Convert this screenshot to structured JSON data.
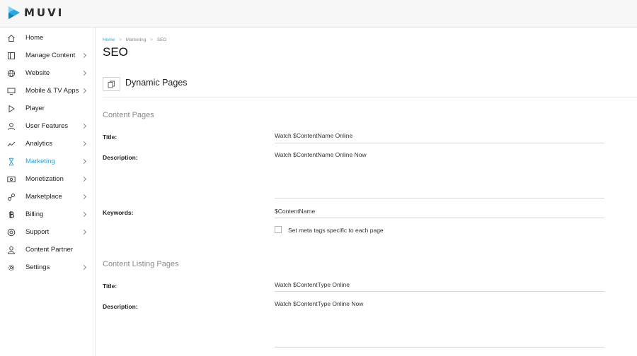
{
  "app": {
    "logo_text": "MUVI"
  },
  "sidebar": {
    "items": [
      {
        "label": "Home",
        "icon": "home-icon",
        "chevron": false,
        "active": false
      },
      {
        "label": "Manage Content",
        "icon": "content-icon",
        "chevron": true,
        "active": false
      },
      {
        "label": "Website",
        "icon": "globe-icon",
        "chevron": true,
        "active": false
      },
      {
        "label": "Mobile & TV Apps",
        "icon": "monitor-icon",
        "chevron": true,
        "active": false
      },
      {
        "label": "Player",
        "icon": "play-icon",
        "chevron": false,
        "active": false
      },
      {
        "label": "User Features",
        "icon": "user-icon",
        "chevron": true,
        "active": false
      },
      {
        "label": "Analytics",
        "icon": "analytics-icon",
        "chevron": true,
        "active": false
      },
      {
        "label": "Marketing",
        "icon": "hourglass-icon",
        "chevron": true,
        "active": true
      },
      {
        "label": "Monetization",
        "icon": "money-icon",
        "chevron": true,
        "active": false
      },
      {
        "label": "Marketplace",
        "icon": "link-icon",
        "chevron": true,
        "active": false
      },
      {
        "label": "Billing",
        "icon": "bitcoin-icon",
        "chevron": true,
        "active": false
      },
      {
        "label": "Support",
        "icon": "support-icon",
        "chevron": true,
        "active": false
      },
      {
        "label": "Content Partner",
        "icon": "partner-icon",
        "chevron": false,
        "active": false
      },
      {
        "label": "Settings",
        "icon": "gear-icon",
        "chevron": true,
        "active": false
      }
    ]
  },
  "breadcrumb": {
    "home": "Home",
    "marketing": "Marketing",
    "current": "SEO",
    "separator": ">"
  },
  "page": {
    "title": "SEO"
  },
  "dynamic_pages": {
    "title": "Dynamic Pages",
    "icon": "copy-icon"
  },
  "content_pages": {
    "title": "Content Pages",
    "title_label": "Title:",
    "title_value": "Watch $ContentName Online",
    "description_label": "Description:",
    "description_value": "Watch $ContentName Online Now",
    "keywords_label": "Keywords:",
    "keywords_value": "$ContentName",
    "meta_checkbox_label": "Set meta tags specific to each page",
    "meta_checkbox_checked": false
  },
  "content_listing_pages": {
    "title": "Content Listing Pages",
    "title_label": "Title:",
    "title_value": "Watch $ContentType Online",
    "description_label": "Description:",
    "description_value": "Watch $ContentType Online Now"
  },
  "colors": {
    "accent": "#2a9fd6",
    "logo": "#29a8e0"
  }
}
